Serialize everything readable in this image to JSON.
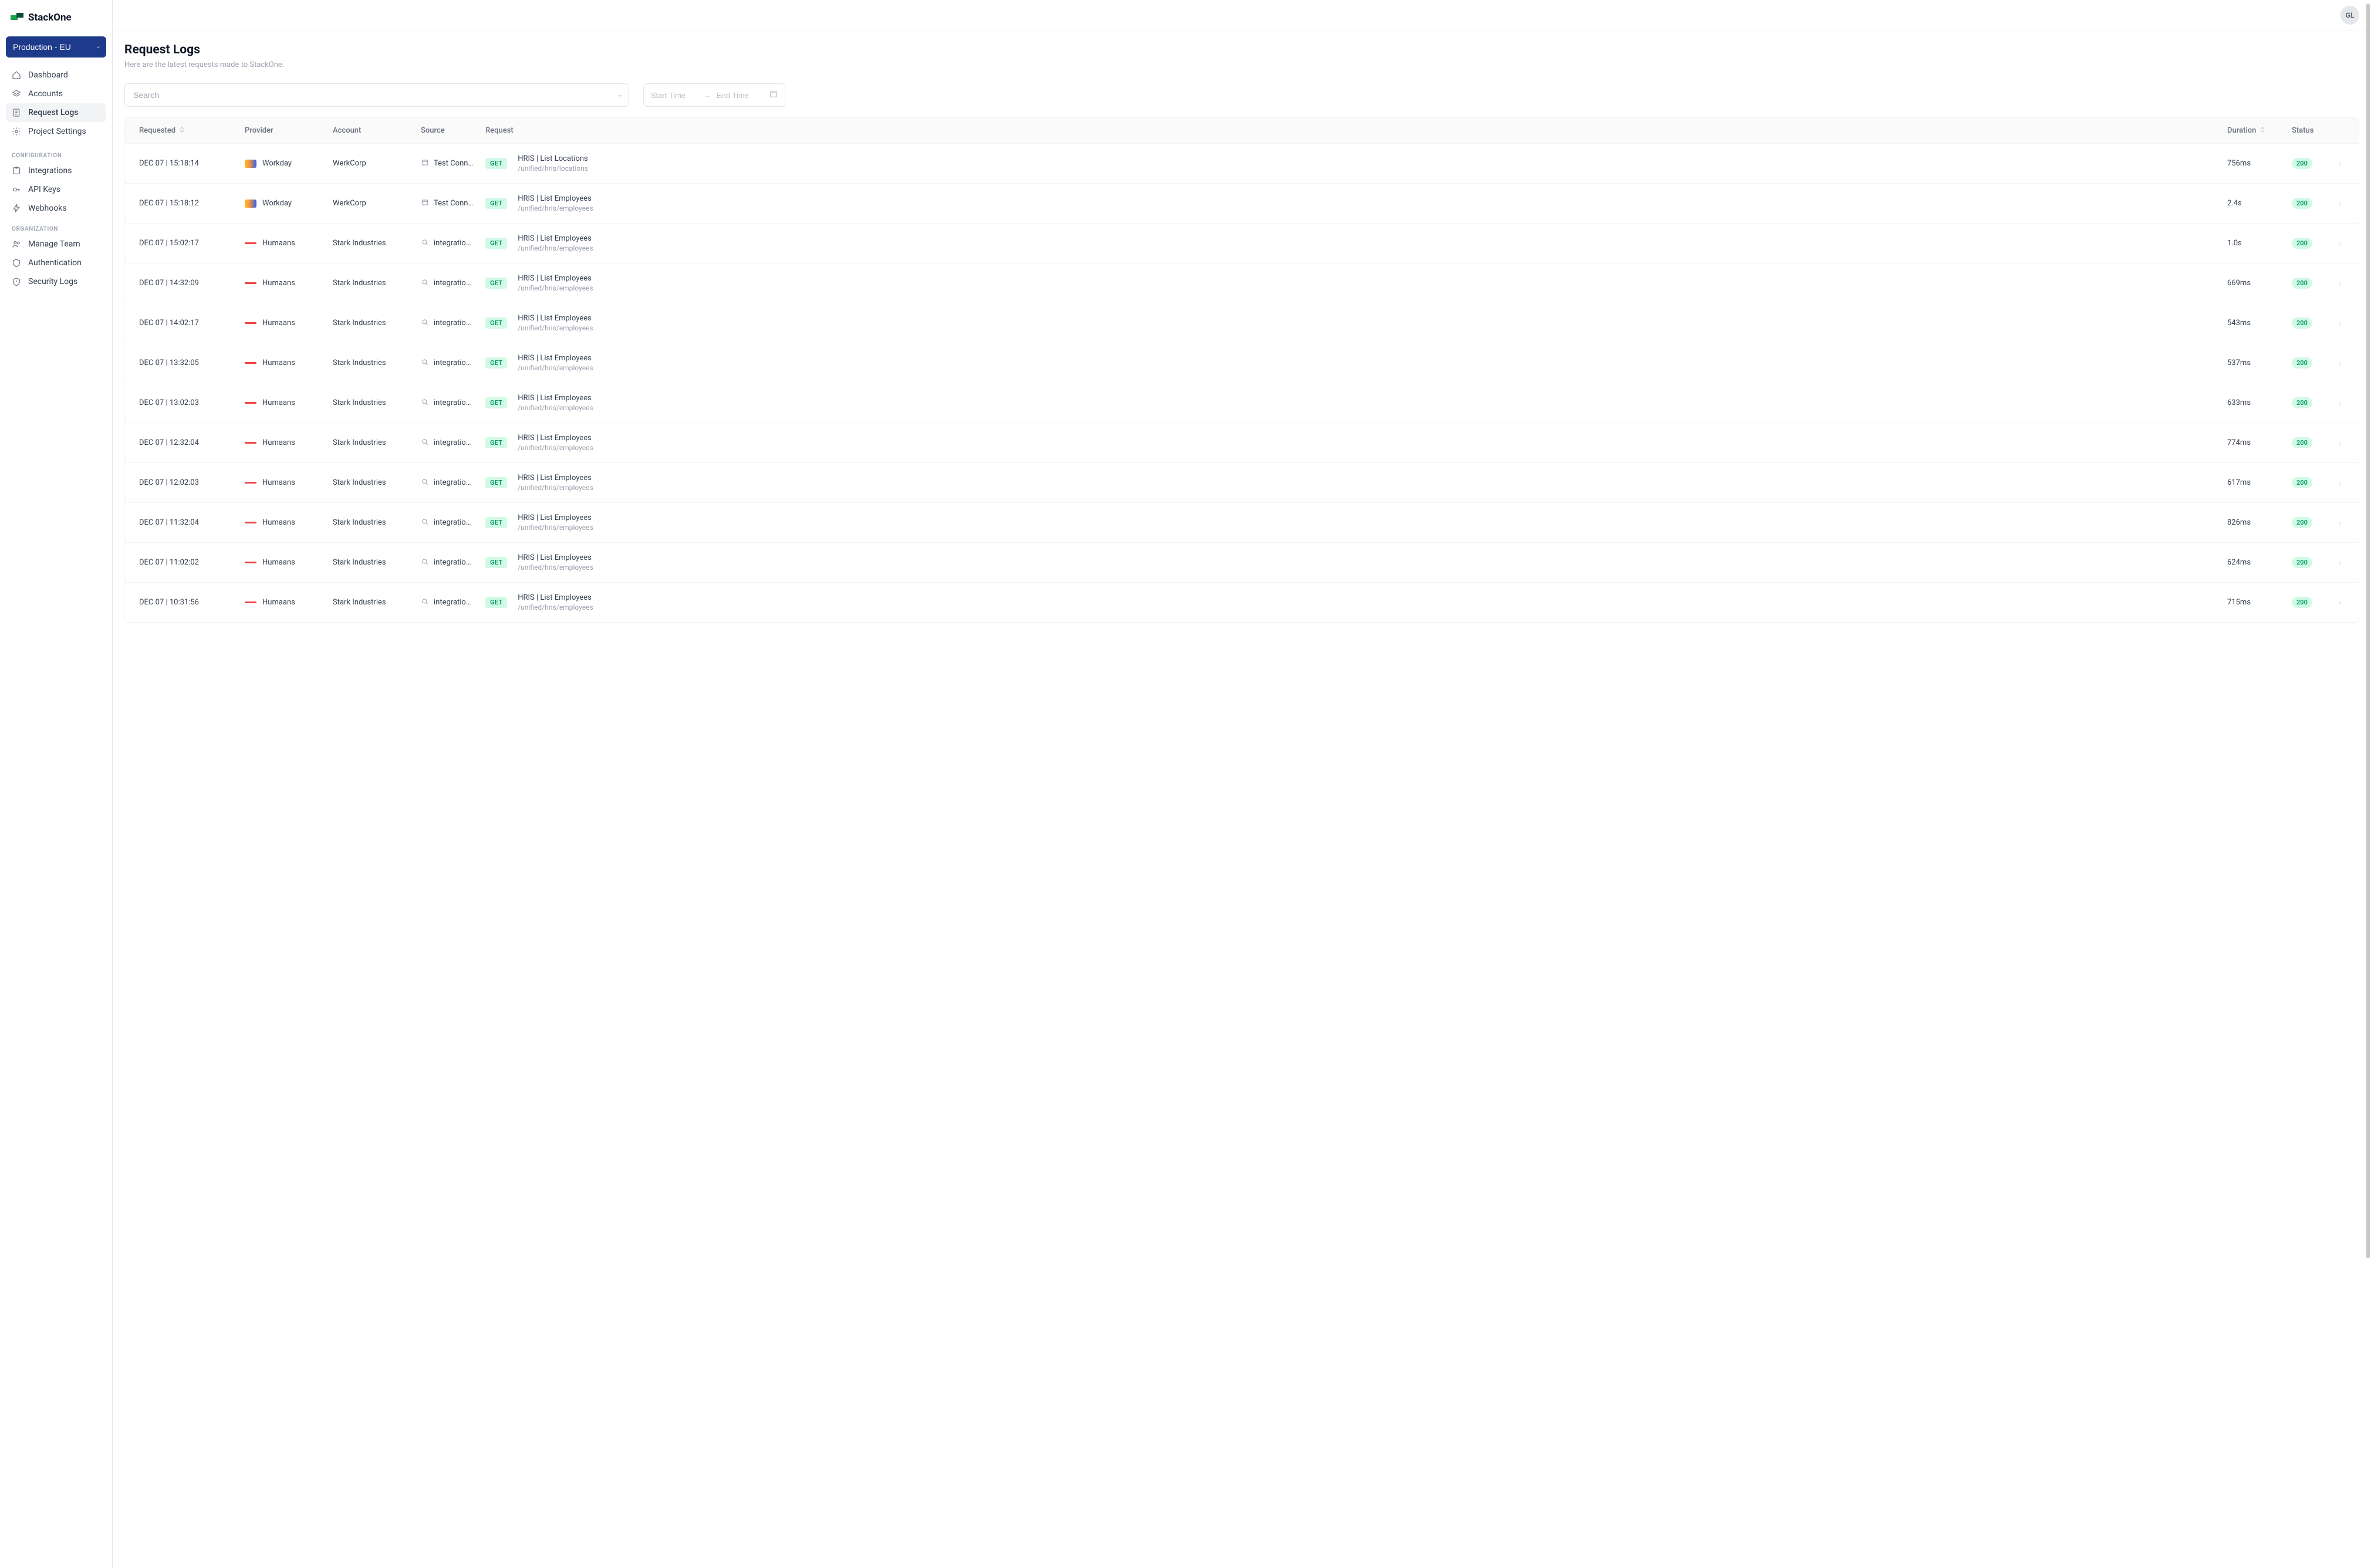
{
  "brand": "StackOne",
  "env_label": "Production - EU",
  "avatar_initials": "GL",
  "sidebar": {
    "main_items": [
      {
        "label": "Dashboard",
        "icon": "home",
        "active": false
      },
      {
        "label": "Accounts",
        "icon": "layers",
        "active": false
      },
      {
        "label": "Request Logs",
        "icon": "file",
        "active": true
      },
      {
        "label": "Project Settings",
        "icon": "gear",
        "active": false
      }
    ],
    "sections": [
      {
        "heading": "CONFIGURATION",
        "items": [
          {
            "label": "Integrations",
            "icon": "puzzle"
          },
          {
            "label": "API Keys",
            "icon": "key"
          },
          {
            "label": "Webhooks",
            "icon": "bolt"
          }
        ]
      },
      {
        "heading": "ORGANIZATION",
        "items": [
          {
            "label": "Manage Team",
            "icon": "users"
          },
          {
            "label": "Authentication",
            "icon": "shield"
          },
          {
            "label": "Security Logs",
            "icon": "shield-alert"
          }
        ]
      }
    ]
  },
  "page": {
    "title": "Request Logs",
    "subtitle": "Here are the latest requests made to StackOne."
  },
  "filters": {
    "search_placeholder": "Search",
    "start_placeholder": "Start Time",
    "end_placeholder": "End Time"
  },
  "table": {
    "columns": [
      "Requested",
      "Provider",
      "Account",
      "Source",
      "Request",
      "Duration",
      "Status"
    ],
    "rows": [
      {
        "requested": "DEC 07 | 15:18:14",
        "provider": "Workday",
        "provider_logo": "workday",
        "account": "WerkCorp",
        "source": "Test Connect…",
        "source_icon": "window",
        "method": "GET",
        "request_title": "HRIS | List Locations",
        "request_path": "/unified/hris/locations",
        "duration": "756ms",
        "status": "200"
      },
      {
        "requested": "DEC 07 | 15:18:12",
        "provider": "Workday",
        "provider_logo": "workday",
        "account": "WerkCorp",
        "source": "Test Connect…",
        "source_icon": "window",
        "method": "GET",
        "request_title": "HRIS | List Employees",
        "request_path": "/unified/hris/employees",
        "duration": "2.4s",
        "status": "200"
      },
      {
        "requested": "DEC 07 | 15:02:17",
        "provider": "Humaans",
        "provider_logo": "humaans",
        "account": "Stark Industries",
        "source": "integration-s…",
        "source_icon": "search",
        "method": "GET",
        "request_title": "HRIS | List Employees",
        "request_path": "/unified/hris/employees",
        "duration": "1.0s",
        "status": "200"
      },
      {
        "requested": "DEC 07 | 14:32:09",
        "provider": "Humaans",
        "provider_logo": "humaans",
        "account": "Stark Industries",
        "source": "integration-s…",
        "source_icon": "search",
        "method": "GET",
        "request_title": "HRIS | List Employees",
        "request_path": "/unified/hris/employees",
        "duration": "669ms",
        "status": "200"
      },
      {
        "requested": "DEC 07 | 14:02:17",
        "provider": "Humaans",
        "provider_logo": "humaans",
        "account": "Stark Industries",
        "source": "integration-s…",
        "source_icon": "search",
        "method": "GET",
        "request_title": "HRIS | List Employees",
        "request_path": "/unified/hris/employees",
        "duration": "543ms",
        "status": "200"
      },
      {
        "requested": "DEC 07 | 13:32:05",
        "provider": "Humaans",
        "provider_logo": "humaans",
        "account": "Stark Industries",
        "source": "integration-s…",
        "source_icon": "search",
        "method": "GET",
        "request_title": "HRIS | List Employees",
        "request_path": "/unified/hris/employees",
        "duration": "537ms",
        "status": "200"
      },
      {
        "requested": "DEC 07 | 13:02:03",
        "provider": "Humaans",
        "provider_logo": "humaans",
        "account": "Stark Industries",
        "source": "integration-s…",
        "source_icon": "search",
        "method": "GET",
        "request_title": "HRIS | List Employees",
        "request_path": "/unified/hris/employees",
        "duration": "633ms",
        "status": "200"
      },
      {
        "requested": "DEC 07 | 12:32:04",
        "provider": "Humaans",
        "provider_logo": "humaans",
        "account": "Stark Industries",
        "source": "integration-s…",
        "source_icon": "search",
        "method": "GET",
        "request_title": "HRIS | List Employees",
        "request_path": "/unified/hris/employees",
        "duration": "774ms",
        "status": "200"
      },
      {
        "requested": "DEC 07 | 12:02:03",
        "provider": "Humaans",
        "provider_logo": "humaans",
        "account": "Stark Industries",
        "source": "integration-s…",
        "source_icon": "search",
        "method": "GET",
        "request_title": "HRIS | List Employees",
        "request_path": "/unified/hris/employees",
        "duration": "617ms",
        "status": "200"
      },
      {
        "requested": "DEC 07 | 11:32:04",
        "provider": "Humaans",
        "provider_logo": "humaans",
        "account": "Stark Industries",
        "source": "integration-s…",
        "source_icon": "search",
        "method": "GET",
        "request_title": "HRIS | List Employees",
        "request_path": "/unified/hris/employees",
        "duration": "826ms",
        "status": "200"
      },
      {
        "requested": "DEC 07 | 11:02:02",
        "provider": "Humaans",
        "provider_logo": "humaans",
        "account": "Stark Industries",
        "source": "integration-s…",
        "source_icon": "search",
        "method": "GET",
        "request_title": "HRIS | List Employees",
        "request_path": "/unified/hris/employees",
        "duration": "624ms",
        "status": "200"
      },
      {
        "requested": "DEC 07 | 10:31:56",
        "provider": "Humaans",
        "provider_logo": "humaans",
        "account": "Stark Industries",
        "source": "integration-s…",
        "source_icon": "search",
        "method": "GET",
        "request_title": "HRIS | List Employees",
        "request_path": "/unified/hris/employees",
        "duration": "715ms",
        "status": "200"
      }
    ]
  }
}
